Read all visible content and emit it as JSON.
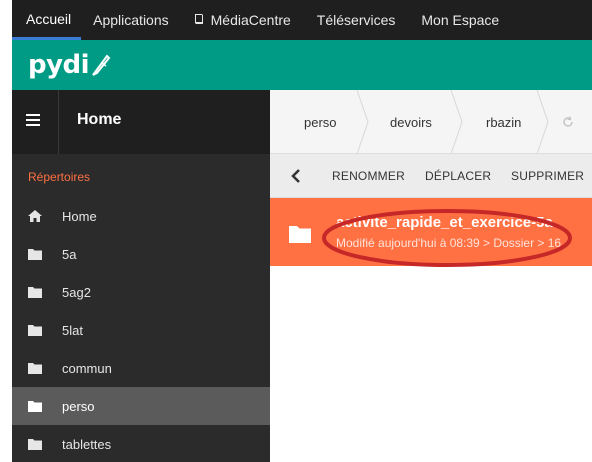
{
  "topnav": {
    "items": [
      {
        "label": "Accueil",
        "active": true
      },
      {
        "label": "Applications"
      },
      {
        "label": "MédiaCentre",
        "icon": "book-icon"
      },
      {
        "label": "Téléservices"
      },
      {
        "label": "Mon Espace"
      }
    ]
  },
  "brand": {
    "logo_text": "pydi",
    "color": "#009b85"
  },
  "sidebar": {
    "title": "Home",
    "section_label": "Répertoires",
    "items": [
      {
        "label": "Home",
        "icon": "home-icon"
      },
      {
        "label": "5a",
        "icon": "folder-icon"
      },
      {
        "label": "5ag2",
        "icon": "folder-icon"
      },
      {
        "label": "5lat",
        "icon": "folder-icon"
      },
      {
        "label": "commun",
        "icon": "folder-icon"
      },
      {
        "label": "perso",
        "icon": "folder-icon",
        "selected": true
      },
      {
        "label": "tablettes",
        "icon": "folder-icon"
      }
    ]
  },
  "breadcrumb": {
    "items": [
      "perso",
      "devoirs",
      "rbazin"
    ],
    "trailing_icon": "refresh-icon"
  },
  "toolbar": {
    "back_icon": "chevron-left-icon",
    "rename": "RENOMMER",
    "move": "DÉPLACER",
    "delete": "SUPPRIMER"
  },
  "file": {
    "name": "activite_rapide_et_exercice-5a",
    "meta": "Modifié aujourd'hui à 08:39 > Dossier > 16",
    "icon": "folder-icon",
    "highlight_color": "#ff7043"
  },
  "colors": {
    "accent": "#ff7043",
    "annotation": "#c62828",
    "dark": "#1f1f1f"
  }
}
